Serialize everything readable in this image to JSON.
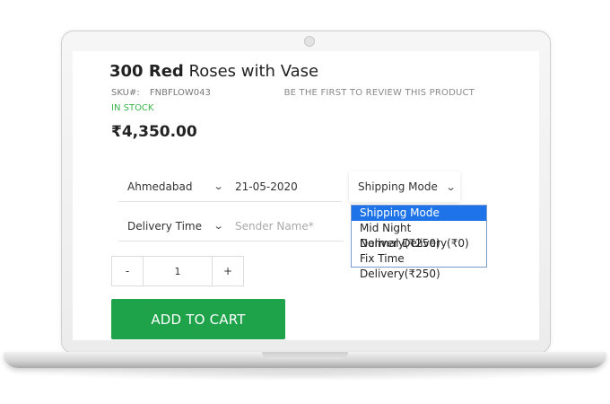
{
  "product": {
    "title_bold": "300 Red",
    "title_rest": " Roses with Vase",
    "sku_label": "SKU#:",
    "sku_value": "FNBFLOW043",
    "review_link": "BE THE FIRST TO REVIEW THIS PRODUCT",
    "stock_status": "IN STOCK",
    "price": "₹4,350.00"
  },
  "form": {
    "city": "Ahmedabad",
    "date": "21-05-2020",
    "shipping_mode_label": "Shipping Mode",
    "delivery_time": "Delivery Time",
    "sender_placeholder": "Sender Name*"
  },
  "shipping_options": [
    "Shipping Mode",
    "Mid Night Delivery(₹250)",
    "Normal Delivery(₹0)",
    "Fix Time Delivery(₹250)"
  ],
  "selected_option_index": 0,
  "quantity": {
    "minus": "-",
    "value": "1",
    "plus": "+"
  },
  "cart_button": "ADD TO CART",
  "colors": {
    "accent_green": "#1ea24a",
    "stock_green": "#3bb54a",
    "selected_blue": "#1e73e8"
  },
  "icons": {
    "dropdown_chevron": "chevron-down-icon"
  }
}
